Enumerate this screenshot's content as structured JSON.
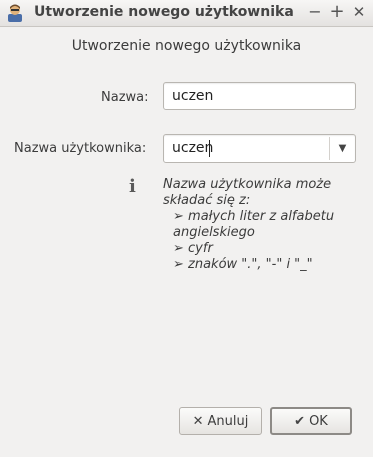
{
  "window": {
    "title": "Utworzenie nowego użytkownika",
    "icon": "user-admin-icon",
    "controls": {
      "minimize": "−",
      "maximize": "+",
      "close": "✕"
    }
  },
  "dialog": {
    "heading": "Utworzenie nowego użytkownika",
    "name_label": "Nazwa:",
    "name_value": "uczen",
    "username_label": "Nazwa użytkownika:",
    "username_value": "uczen",
    "info_icon_glyph": "i",
    "hint": {
      "intro": "Nazwa użytkownika może składać się z:",
      "items": [
        "➢ małych liter z alfabetu angielskiego",
        "➢ cyfr",
        "➢ znaków \".\", \"-\" i \"_\""
      ]
    }
  },
  "buttons": {
    "cancel_label": "Anuluj",
    "cancel_icon": "✕",
    "ok_label": "OK",
    "ok_icon": "✔"
  },
  "colors": {
    "background": "#f2f1f0",
    "text": "#3c3c3c"
  }
}
